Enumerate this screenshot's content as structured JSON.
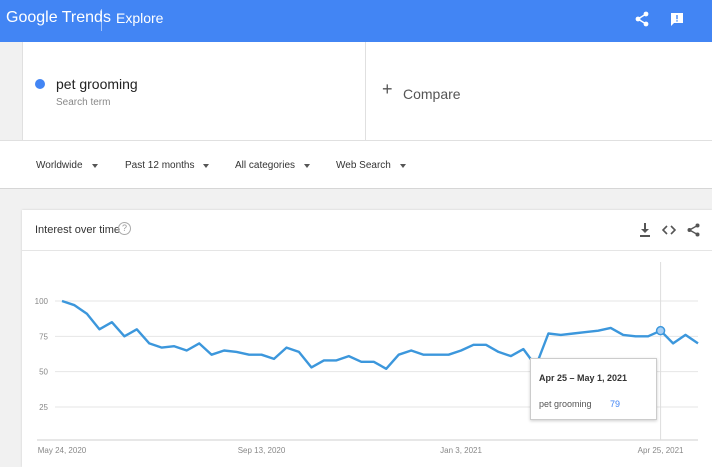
{
  "header": {
    "brand": "Google Trends",
    "section": "Explore",
    "share_icon": "share-icon",
    "feedback_icon": "feedback-icon",
    "bar_color": "#4285f4"
  },
  "search": {
    "term": "pet grooming",
    "term_type": "Search term",
    "term_color": "#4285f4",
    "compare_label": "Compare"
  },
  "filters": [
    {
      "label": "Worldwide"
    },
    {
      "label": "Past 12 months"
    },
    {
      "label": "All categories"
    },
    {
      "label": "Web Search"
    }
  ],
  "card": {
    "title": "Interest over time",
    "help_icon": "help-icon",
    "actions": [
      "download-icon",
      "embed-icon",
      "share-icon"
    ]
  },
  "tooltip": {
    "title": "Apr 25 – May 1, 2021",
    "label": "pet grooming",
    "value": "79"
  },
  "chart_data": {
    "type": "line",
    "title": "",
    "xlabel": "",
    "ylabel": "",
    "ylim": [
      0,
      100
    ],
    "yticks": [
      25,
      50,
      75,
      100
    ],
    "grid": true,
    "x_tick_labels": [
      "May 24, 2020",
      "Sep 13, 2020",
      "Jan 3, 2021",
      "Apr 25, 2021"
    ],
    "series": [
      {
        "name": "pet grooming",
        "color": "#4285f4",
        "values": [
          100,
          97,
          91,
          80,
          85,
          75,
          80,
          70,
          67,
          68,
          65,
          70,
          62,
          65,
          64,
          62,
          62,
          59,
          67,
          64,
          53,
          58,
          58,
          61,
          57,
          57,
          52,
          62,
          65,
          62,
          62,
          62,
          65,
          69,
          69,
          64,
          61,
          66,
          54,
          77,
          76,
          77,
          78,
          79,
          81,
          76,
          75,
          75,
          79,
          70,
          76,
          70
        ]
      }
    ],
    "highlight_index": 48
  }
}
